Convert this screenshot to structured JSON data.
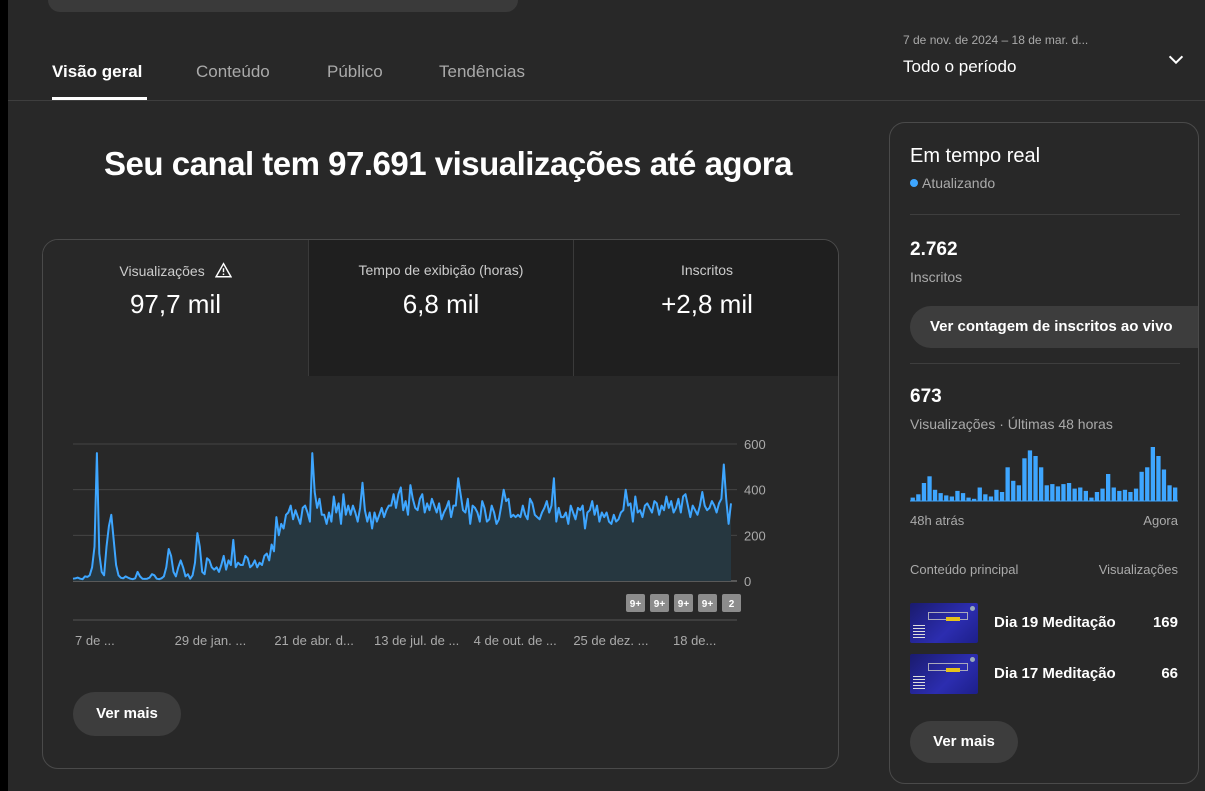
{
  "tabs": [
    {
      "label": "Visão geral",
      "active": true
    },
    {
      "label": "Conteúdo",
      "active": false
    },
    {
      "label": "Público",
      "active": false
    },
    {
      "label": "Tendências",
      "active": false
    }
  ],
  "period": {
    "range": "7 de nov. de 2024 – 18 de mar. d...",
    "label": "Todo o período",
    "icon": "chevron-down-icon"
  },
  "headline": "Seu canal tem 97.691 visualizações até agora",
  "metrics": [
    {
      "label": "Visualizações",
      "value": "97,7 mil",
      "icon": "warning-icon"
    },
    {
      "label": "Tempo de exibição (horas)",
      "value": "6,8 mil"
    },
    {
      "label": "Inscritos",
      "value": "+2,8 mil"
    }
  ],
  "main_button": "Ver mais",
  "chart_data": {
    "type": "area",
    "series": [
      {
        "values": [
          10,
          12,
          15,
          10,
          8,
          20,
          18,
          25,
          60,
          150,
          560,
          120,
          40,
          25,
          150,
          240,
          290,
          180,
          70,
          25,
          14,
          12,
          20,
          15,
          10,
          8,
          12,
          40,
          20,
          10,
          9,
          10,
          15,
          30,
          25,
          10,
          8,
          12,
          20,
          60,
          140,
          110,
          40,
          20,
          60,
          90,
          60,
          20,
          30,
          10,
          25,
          80,
          210,
          150,
          40,
          30,
          100,
          90,
          60,
          50,
          60,
          40,
          70,
          110,
          50,
          90,
          70,
          180,
          60,
          80,
          70,
          70,
          110,
          100,
          60,
          70,
          90,
          60,
          80,
          70,
          110,
          120,
          90,
          160,
          130,
          280,
          200,
          250,
          230,
          290,
          300,
          330,
          270,
          310,
          280,
          250,
          320,
          330,
          300,
          260,
          560,
          390,
          320,
          360,
          290,
          290,
          250,
          300,
          260,
          370,
          300,
          340,
          250,
          380,
          290,
          330,
          290,
          330,
          300,
          260,
          320,
          430,
          310,
          260,
          300,
          230,
          300,
          260,
          290,
          320,
          280,
          310,
          330,
          330,
          380,
          320,
          380,
          410,
          310,
          350,
          290,
          420,
          360,
          320,
          310,
          360,
          380,
          300,
          340,
          310,
          360,
          330,
          300,
          340,
          270,
          300,
          320,
          350,
          280,
          330,
          330,
          450,
          380,
          310,
          300,
          360,
          250,
          330,
          320,
          300,
          260,
          350,
          320,
          260,
          270,
          330,
          300,
          250,
          270,
          330,
          400,
          350,
          360,
          280,
          290,
          280,
          290,
          280,
          330,
          290,
          270,
          360,
          340,
          290,
          280,
          270,
          300,
          320,
          350,
          300,
          330,
          450,
          260,
          320,
          280,
          280,
          300,
          250,
          330,
          300,
          270,
          320,
          310,
          330,
          230,
          300,
          310,
          350,
          290,
          330,
          260,
          300,
          280,
          300,
          260,
          250,
          290,
          260,
          270,
          300,
          310,
          400,
          330,
          340,
          260,
          370,
          300,
          310,
          280,
          330,
          340,
          320,
          300,
          350,
          340,
          290,
          330,
          310,
          370,
          320,
          350,
          300,
          320,
          360,
          300,
          370,
          380,
          330,
          280,
          330,
          310,
          290,
          330,
          390,
          330,
          310,
          320,
          350,
          330,
          300,
          340,
          360,
          510,
          360,
          250,
          340
        ]
      }
    ],
    "x_tick_labels": [
      "7 de ...",
      "29 de jan. ...",
      "21 de abr. d...",
      "13 de jul. de ...",
      "4 de out. de ...",
      "25 de dez. ...",
      "18 de..."
    ],
    "y_ticks": [
      "600",
      "400",
      "200",
      "0"
    ],
    "ylim": [
      0,
      600
    ],
    "badges": [
      "9+",
      "9+",
      "9+",
      "9+",
      "2"
    ],
    "grid": true,
    "line_color": "#3ea6ff",
    "fill_color": "#263740"
  },
  "realtime": {
    "title": "Em tempo real",
    "status": "Atualizando",
    "subs_value": "2.762",
    "subs_label": "Inscritos",
    "live_button": "Ver contagem de inscritos ao vivo",
    "views_value": "673",
    "views_label": "Visualizações · Últimas 48 horas",
    "axis_left": "48h atrás",
    "axis_right": "Agora",
    "hourly_views": [
      3,
      6,
      16,
      22,
      10,
      7,
      5,
      4,
      9,
      7,
      3,
      2,
      12,
      6,
      4,
      10,
      8,
      30,
      18,
      14,
      38,
      45,
      40,
      30,
      14,
      15,
      13,
      15,
      16,
      11,
      12,
      9,
      3,
      8,
      11,
      24,
      12,
      9,
      10,
      8,
      11,
      26,
      30,
      48,
      40,
      28,
      14,
      12
    ],
    "content_header": "Conteúdo principal",
    "views_header": "Visualizações",
    "content": [
      {
        "title": "Dia 19 Meditação",
        "views": "169"
      },
      {
        "title": "Dia 17 Meditação",
        "views": "66"
      }
    ],
    "more_button": "Ver mais"
  }
}
